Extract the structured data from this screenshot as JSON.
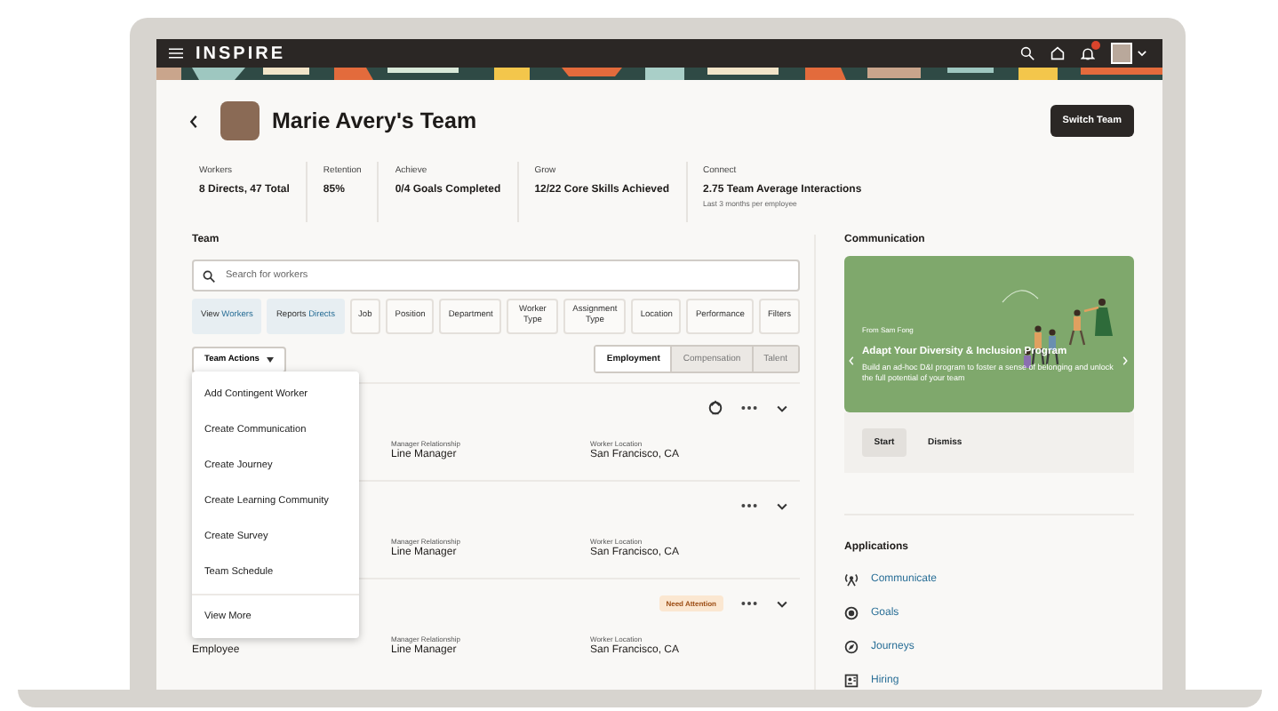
{
  "app": {
    "brand": "INSPIRE"
  },
  "page": {
    "title": "Marie Avery's Team",
    "action": "Switch Team"
  },
  "metrics": [
    {
      "label": "Workers",
      "value": "8 Directs, 47 Total"
    },
    {
      "label": "Retention",
      "value": "85%"
    },
    {
      "label": "Achieve",
      "value": "0/4 Goals Completed"
    },
    {
      "label": "Grow",
      "value": "12/22 Core Skills Achieved"
    },
    {
      "label": "Connect",
      "value": "2.75 Team Average Interactions",
      "note": "Last 3 months per employee"
    }
  ],
  "team": {
    "title": "Team",
    "search": {
      "placeholder": "Search for workers"
    },
    "filters": [
      {
        "kind": "pair",
        "label": "View",
        "value": "Workers"
      },
      {
        "kind": "pair",
        "label": "Reports",
        "value": "Directs"
      },
      {
        "kind": "plain",
        "label": "Job"
      },
      {
        "kind": "plain",
        "label": "Position"
      },
      {
        "kind": "plain",
        "label": "Department"
      },
      {
        "kind": "plain",
        "label": "Worker Type"
      },
      {
        "kind": "plain",
        "label": "Assignment Type"
      },
      {
        "kind": "plain",
        "label": "Location"
      },
      {
        "kind": "plain",
        "label": "Performance"
      },
      {
        "kind": "plain",
        "label": "Filters"
      }
    ],
    "actions_button": "Team Actions",
    "views": [
      {
        "label": "Employment",
        "selected": true
      },
      {
        "label": "Compensation",
        "selected": false
      },
      {
        "label": "Talent",
        "selected": false
      }
    ],
    "rows": [
      {
        "awarded": true,
        "fields": [
          {
            "label": "Manager Relationship",
            "value": "Line Manager"
          },
          {
            "label": "Worker Location",
            "value": "San Francisco, CA"
          }
        ]
      },
      {
        "awarded": false,
        "fields": [
          {
            "label": "Manager Relationship",
            "value": "Line Manager"
          },
          {
            "label": "Worker Location",
            "value": "San Francisco, CA"
          }
        ]
      },
      {
        "awarded": false,
        "badge": "Need Attention",
        "column_1": "Employee",
        "fields": [
          {
            "label": "Manager Relationship",
            "value": "Line Manager"
          },
          {
            "label": "Worker Location",
            "value": "San Francisco, CA"
          }
        ]
      }
    ],
    "menu": {
      "items": [
        "Add Contingent Worker",
        "Create Communication",
        "Create Journey",
        "Create Learning Community",
        "Create Survey",
        "Team Schedule"
      ],
      "footer": "View More"
    }
  },
  "communication": {
    "title": "Communication",
    "card": {
      "from": "From Sam Fong",
      "title": "Adapt Your Diversity & Inclusion Program",
      "text": "Build an ad-hoc D&I program to foster a sense of belonging and unlock the full potential of your team"
    },
    "buttons": [
      {
        "label": "Start",
        "kind": "primary"
      },
      {
        "label": "Dismiss",
        "kind": "plain"
      }
    ]
  },
  "applications": {
    "title": "Applications",
    "items": [
      {
        "label": "Communicate",
        "kind": "broadcast"
      },
      {
        "label": "Goals",
        "kind": "target"
      },
      {
        "label": "Journeys",
        "kind": "compass"
      },
      {
        "label": "Hiring",
        "kind": "badge"
      }
    ]
  }
}
